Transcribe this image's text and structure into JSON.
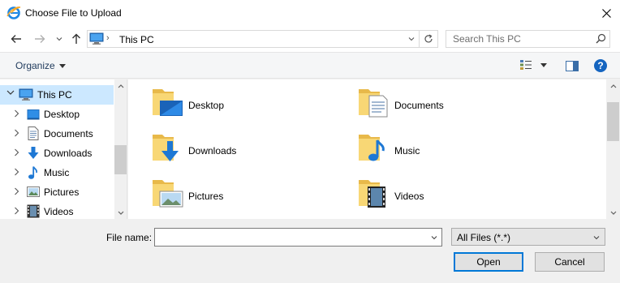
{
  "window": {
    "title": "Choose File to Upload",
    "app_icon": "internet-explorer-icon"
  },
  "nav": {
    "back_icon": "arrow-left-icon",
    "forward_icon": "arrow-right-icon",
    "recent_icon": "chevron-down-icon",
    "up_icon": "arrow-up-icon",
    "address": {
      "location_icon": "this-pc-icon",
      "breadcrumb": "This PC"
    },
    "search": {
      "placeholder": "Search This PC"
    }
  },
  "toolbar": {
    "organize_label": "Organize",
    "view_icon": "details-view-icon",
    "pane_icon": "preview-pane-icon",
    "help_label": "?"
  },
  "tree": {
    "root": {
      "label": "This PC",
      "icon": "this-pc-icon",
      "selected": true
    },
    "items": [
      {
        "label": "Desktop",
        "icon": "desktop-icon"
      },
      {
        "label": "Documents",
        "icon": "documents-icon"
      },
      {
        "label": "Downloads",
        "icon": "downloads-icon"
      },
      {
        "label": "Music",
        "icon": "music-icon"
      },
      {
        "label": "Pictures",
        "icon": "pictures-icon"
      },
      {
        "label": "Videos",
        "icon": "videos-icon"
      }
    ]
  },
  "folders": [
    {
      "label": "Desktop",
      "icon": "desktop-folder-icon"
    },
    {
      "label": "Documents",
      "icon": "documents-folder-icon"
    },
    {
      "label": "Downloads",
      "icon": "downloads-folder-icon"
    },
    {
      "label": "Music",
      "icon": "music-folder-icon"
    },
    {
      "label": "Pictures",
      "icon": "pictures-folder-icon"
    },
    {
      "label": "Videos",
      "icon": "videos-folder-icon"
    }
  ],
  "footer": {
    "file_name_label": "File name:",
    "file_name_value": "",
    "file_type": "All Files (*.*)",
    "open_label": "Open",
    "cancel_label": "Cancel"
  },
  "colors": {
    "accent": "#0078d7",
    "selection": "#cce8ff",
    "folder": "#f8d775"
  }
}
